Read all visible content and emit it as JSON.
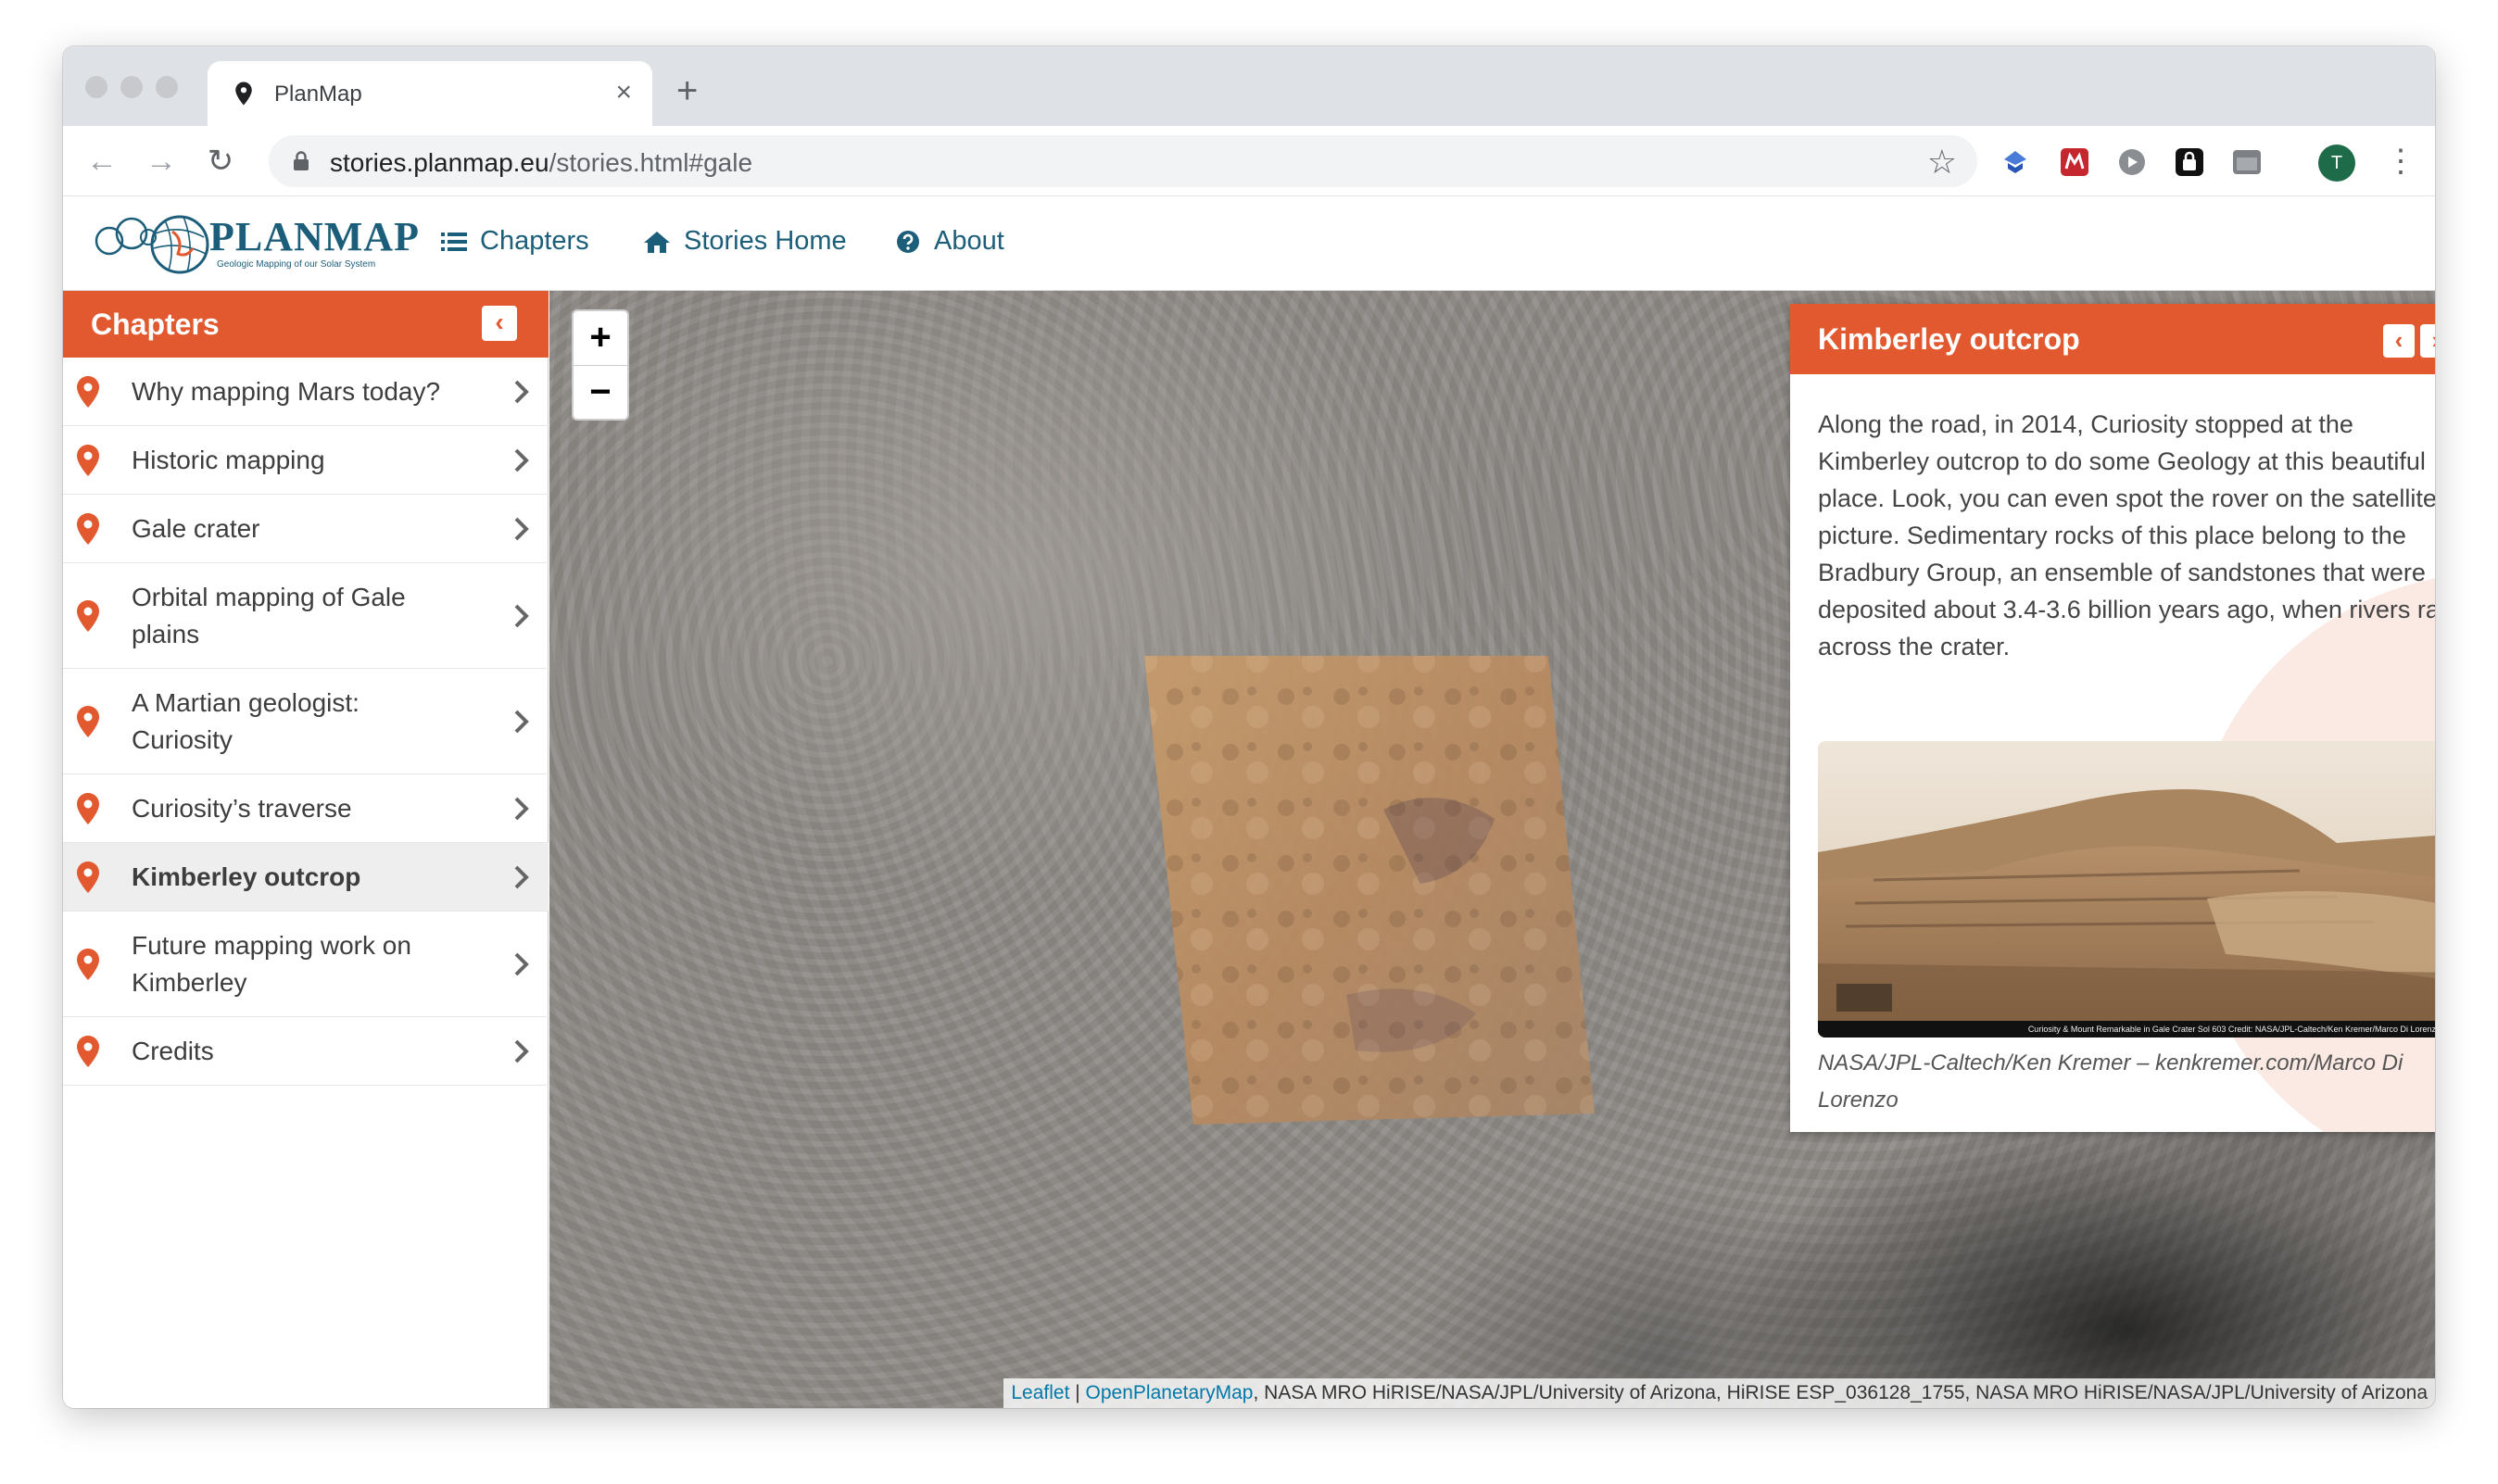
{
  "browser": {
    "tab_title": "PlanMap",
    "url_host": "stories.planmap.eu",
    "url_path": "/stories.html#gale",
    "profile_initial": "T"
  },
  "site": {
    "logo_text": "PLANMAP",
    "logo_subtitle": "Geologic Mapping of our Solar System",
    "nav": [
      {
        "label": "Chapters",
        "icon": "list-icon"
      },
      {
        "label": "Stories Home",
        "icon": "home-icon"
      },
      {
        "label": "About",
        "icon": "question-circle-icon"
      }
    ]
  },
  "sidebar": {
    "title": "Chapters",
    "collapse_label": "‹",
    "items": [
      {
        "label": "Why mapping Mars today?"
      },
      {
        "label": "Historic mapping"
      },
      {
        "label": "Gale crater"
      },
      {
        "label": "Orbital mapping of Gale plains"
      },
      {
        "label": "A Martian geologist: Curiosity"
      },
      {
        "label": "Curiosity’s traverse"
      },
      {
        "label": "Kimberley outcrop",
        "active": true
      },
      {
        "label": "Future mapping work on Kimberley"
      },
      {
        "label": "Credits"
      }
    ]
  },
  "map": {
    "zoom_in": "+",
    "zoom_out": "−",
    "attribution": {
      "leaflet": "Leaflet",
      "separator": " | ",
      "opm": "OpenPlanetaryMap",
      "rest": ", NASA MRO HiRISE/NASA/JPL/University of Arizona, HiRISE ESP_036128_1755, NASA MRO HiRISE/NASA/JPL/University of Arizona"
    }
  },
  "panel": {
    "title": "Kimberley outcrop",
    "prev_label": "‹",
    "next_label": "›",
    "body": "Along the road, in 2014, Curiosity stopped at the Kimberley outcrop to do some Geology at this beautiful place. Look, you can even spot the rover on the satellite picture. Sedimentary rocks of this place belong to the Bradbury Group, an ensemble of sandstones that were deposited about 3.4-3.6 billion years ago, when rivers ran across the crater.",
    "photo_caption": "Curiosity & Mount Remarkable in Gale Crater    Sol 603    Credit: NASA/JPL-Caltech/Ken Kremer/Marco Di Lorenzo",
    "credit": "NASA/JPL-Caltech/Ken Kremer – kenkremer.com/Marco Di Lorenzo"
  },
  "colors": {
    "accent": "#e2592f",
    "brand_blue": "#1c5e7a",
    "link": "#0078a8"
  }
}
